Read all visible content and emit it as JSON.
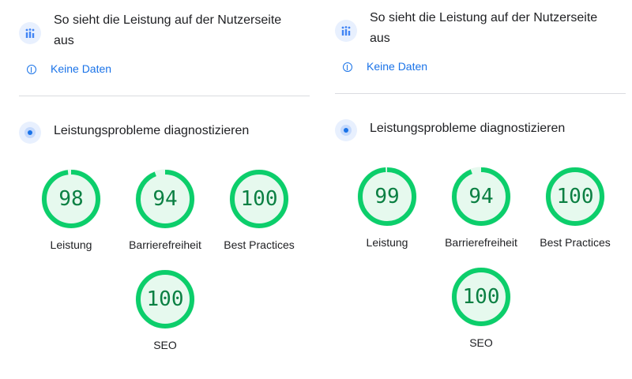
{
  "colors": {
    "pass": "#0cce6b",
    "pass_fill": "#e6f9ee",
    "pass_text": "#0b8043",
    "link": "#1a73e8",
    "divider": "#dadce0"
  },
  "panels": [
    {
      "field_title": "So sieht die Leistung auf der Nutzerseite aus",
      "no_data": "Keine Daten",
      "diag_title": "Leistungsprobleme diagnostizieren",
      "gauges": [
        {
          "score": "98",
          "label": "Leistung",
          "value": 98
        },
        {
          "score": "94",
          "label": "Barrierefreiheit",
          "value": 94
        },
        {
          "score": "100",
          "label": "Best Practices",
          "value": 100
        },
        {
          "score": "100",
          "label": "SEO",
          "value": 100
        }
      ]
    },
    {
      "field_title": "So sieht die Leistung auf der Nutzerseite aus",
      "no_data": "Keine Daten",
      "diag_title": "Leistungsprobleme diagnostizieren",
      "gauges": [
        {
          "score": "99",
          "label": "Leistung",
          "value": 99
        },
        {
          "score": "94",
          "label": "Barrierefreiheit",
          "value": 94
        },
        {
          "score": "100",
          "label": "Best Practices",
          "value": 100
        },
        {
          "score": "100",
          "label": "SEO",
          "value": 100
        }
      ]
    }
  ]
}
